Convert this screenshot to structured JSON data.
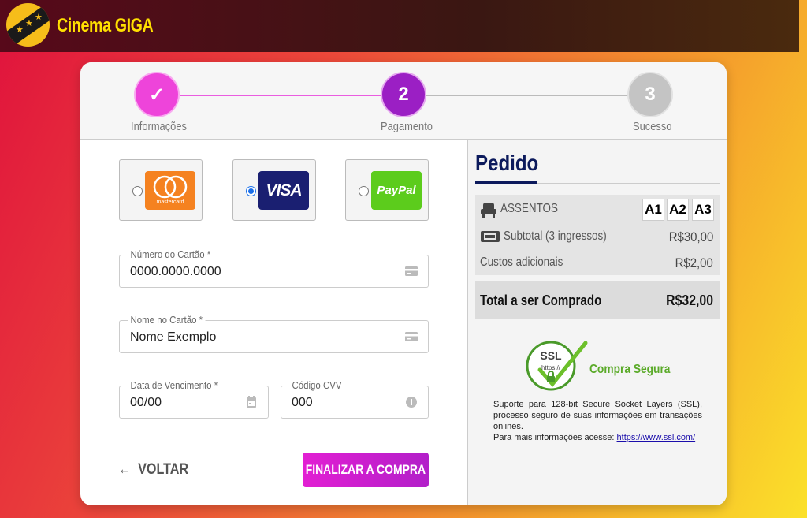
{
  "header": {
    "brand": "Cinema GIGA"
  },
  "stepper": {
    "steps": [
      {
        "number": "✓",
        "label": "Informações"
      },
      {
        "number": "2",
        "label": "Pagamento"
      },
      {
        "number": "3",
        "label": "Sucesso"
      }
    ]
  },
  "payment": {
    "methods": [
      {
        "name": "mastercard",
        "label": "mastercard",
        "selected": false
      },
      {
        "name": "visa",
        "label": "VISA",
        "selected": true
      },
      {
        "name": "paypal",
        "label": "PayPal",
        "selected": false
      }
    ],
    "card_number": {
      "label": "Número do Cartão *",
      "value": "0000.0000.0000"
    },
    "card_name": {
      "label": "Nome no Cartão *",
      "value": "Nome Exemplo"
    },
    "expiry": {
      "label": "Data de Vencimento *",
      "value": "00/00"
    },
    "cvv": {
      "label": "Código CVV",
      "value": "000"
    },
    "back_label": "VOLTAR",
    "finish_label": "FINALIZAR A COMPRA"
  },
  "order": {
    "title": "Pedido",
    "seats_label": "ASSENTOS",
    "seats": [
      "A1",
      "A2",
      "A3"
    ],
    "subtotal_label": "Subtotal (3 ingressos)",
    "subtotal_value": "R$30,00",
    "extra_label": "Custos adicionais",
    "extra_value": "R$2,00",
    "total_label": "Total a ser Comprado",
    "total_value": "R$32,00",
    "ssl": {
      "badge": "SSL",
      "badge_sub": "https://",
      "title": "Compra Segura",
      "text": "Suporte para 128-bit Secure Socket Layers (SSL), processo seguro de suas informações em transações onlines.",
      "more": "Para mais informações acesse:",
      "link": "https://www.ssl.com/"
    }
  },
  "colors": {
    "accent": "#e21fd3",
    "step_active": "#9b1fc4",
    "step_done": "#ee44da",
    "navy": "#0c1a5c"
  }
}
